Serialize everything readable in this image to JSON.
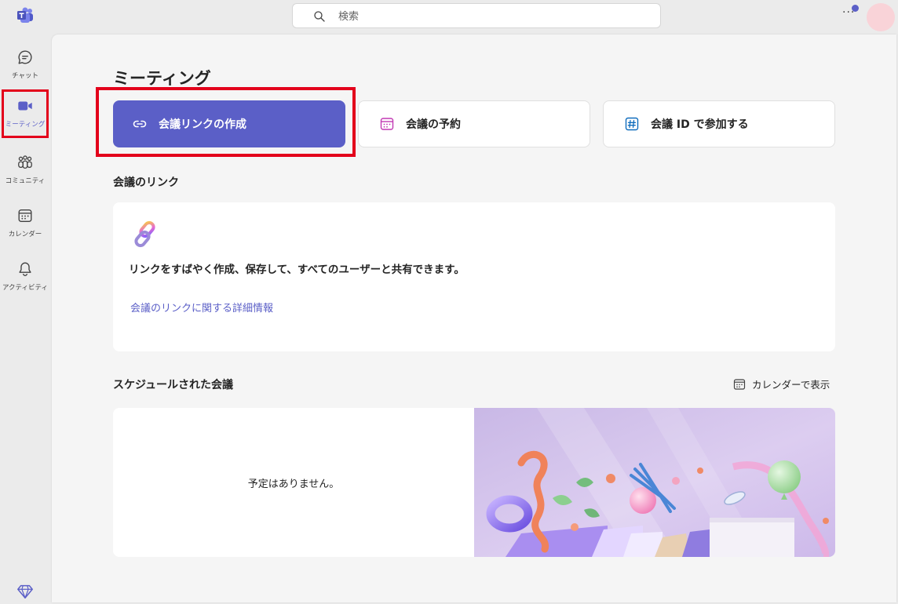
{
  "search": {
    "placeholder": "検索"
  },
  "topbar": {
    "more": "···"
  },
  "rail": [
    {
      "label": "チャット",
      "icon": "chat-icon"
    },
    {
      "label": "ミーティング",
      "icon": "video-icon",
      "active": true
    },
    {
      "label": "コミュニティ",
      "icon": "community-icon"
    },
    {
      "label": "カレンダー",
      "icon": "calendar-icon"
    },
    {
      "label": "アクティビティ",
      "icon": "bell-icon"
    }
  ],
  "page": {
    "title": "ミーティング"
  },
  "actions": {
    "create_link": "会議リンクの作成",
    "schedule": "会議の予約",
    "join_id": "会議 ID で参加する"
  },
  "links": {
    "title": "会議のリンク",
    "description": "リンクをすばやく作成、保存して、すべてのユーザーと共有できます。",
    "learn_more": "会議のリンクに関する詳細情報"
  },
  "scheduled": {
    "title": "スケジュールされた会議",
    "calendar_view": "カレンダーで表示",
    "empty": "予定はありません。"
  },
  "colors": {
    "accent": "#5b5fc7",
    "highlight": "#e3001b"
  }
}
